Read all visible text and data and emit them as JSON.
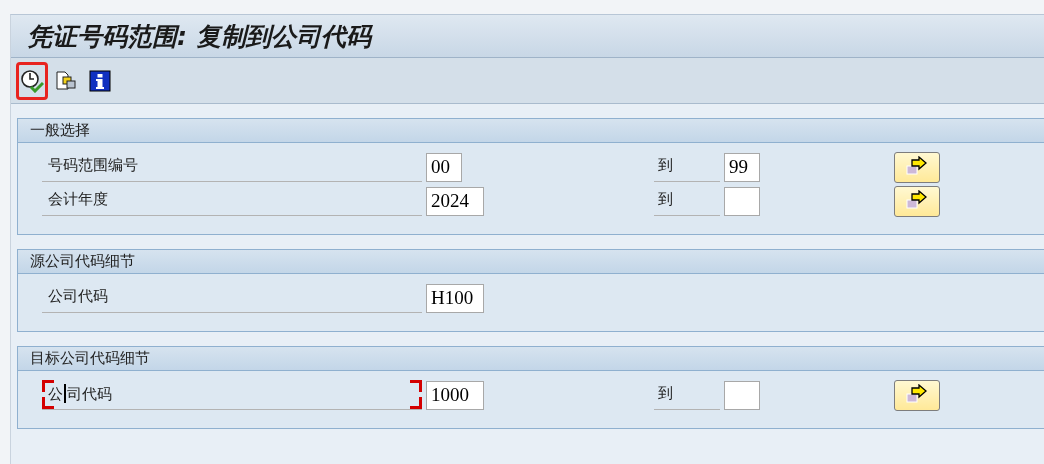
{
  "title": "凭证号码范围: 复制到公司代码",
  "toolbar": [
    {
      "kind": "execute",
      "highlighted": true
    },
    {
      "kind": "copy",
      "highlighted": false
    },
    {
      "kind": "info",
      "highlighted": false
    }
  ],
  "groups": [
    {
      "title": "一般选择",
      "rows": [
        {
          "label": "号码范围编号",
          "focused": false,
          "value": "00",
          "to_label": "到",
          "to_value": "99",
          "button": true
        },
        {
          "label": "会计年度",
          "focused": false,
          "value": "2024",
          "to_label": "到",
          "button": true
        }
      ]
    },
    {
      "title": "源公司代码细节",
      "rows": [
        {
          "label": "公司代码",
          "focused": false,
          "value": "H100",
          "button": false
        }
      ]
    },
    {
      "title": "目标公司代码细节",
      "rows": [
        {
          "label": "公司代码",
          "focused": true,
          "value": "1000",
          "to_label": "到",
          "button": true
        }
      ]
    }
  ]
}
